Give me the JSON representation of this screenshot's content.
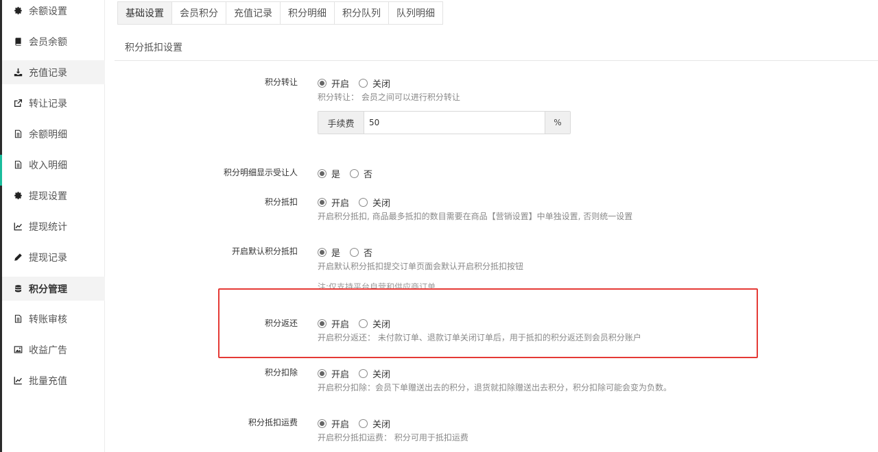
{
  "sidebar": {
    "items": [
      {
        "label": "余额设置",
        "icon": "gear-icon"
      },
      {
        "label": "会员余额",
        "icon": "book-icon"
      },
      {
        "label": "充值记录",
        "icon": "download-icon"
      },
      {
        "label": "转让记录",
        "icon": "external-link-icon"
      },
      {
        "label": "余额明细",
        "icon": "document-icon"
      },
      {
        "label": "收入明细",
        "icon": "document-icon"
      },
      {
        "label": "提现设置",
        "icon": "gear-icon"
      },
      {
        "label": "提现统计",
        "icon": "line-chart-icon"
      },
      {
        "label": "提现记录",
        "icon": "pencil-icon"
      },
      {
        "label": "积分管理",
        "icon": "database-icon"
      },
      {
        "label": "转账审核",
        "icon": "document-icon"
      },
      {
        "label": "收益广告",
        "icon": "image-icon"
      },
      {
        "label": "批量充值",
        "icon": "line-chart-icon"
      }
    ]
  },
  "tabs": [
    "基础设置",
    "会员积分",
    "充值记录",
    "积分明细",
    "积分队列",
    "队列明细"
  ],
  "section_title": "积分抵扣设置",
  "settings": {
    "transfer": {
      "label": "积分转让",
      "on": "开启",
      "off": "关闭",
      "help": "积分转让： 会员之间可以进行积分转让",
      "fee_label": "手续费",
      "fee_value": "50",
      "fee_unit": "%"
    },
    "show_recipient": {
      "label": "积分明细显示受让人",
      "yes": "是",
      "no": "否"
    },
    "deduct": {
      "label": "积分抵扣",
      "on": "开启",
      "off": "关闭",
      "help": "开启积分抵扣, 商品最多抵扣的数目需要在商品【营销设置】中单独设置, 否则统一设置"
    },
    "default_deduct": {
      "label": "开启默认积分抵扣",
      "yes": "是",
      "no": "否",
      "help": "开启默认积分抵扣提交订单页面会默认开启积分抵扣按钮",
      "note": "注:仅支持平台自营和供应商订单"
    },
    "refund": {
      "label": "积分返还",
      "on": "开启",
      "off": "关闭",
      "help": "开启积分返还： 未付款订单、退款订单关闭订单后，用于抵扣的积分返还到会员积分账户"
    },
    "withhold": {
      "label": "积分扣除",
      "on": "开启",
      "off": "关闭",
      "help": "开启积分扣除：会员下单赠送出去的积分，退货就扣除赠送出去积分，积分扣除可能会变为负数。"
    },
    "shipping": {
      "label": "积分抵扣运费",
      "on": "开启",
      "off": "关闭",
      "help": "开启积分抵扣运费： 积分可用于抵扣运费"
    }
  },
  "colors": {
    "highlight_border": "#e53935",
    "accent": "#1abc9c"
  }
}
